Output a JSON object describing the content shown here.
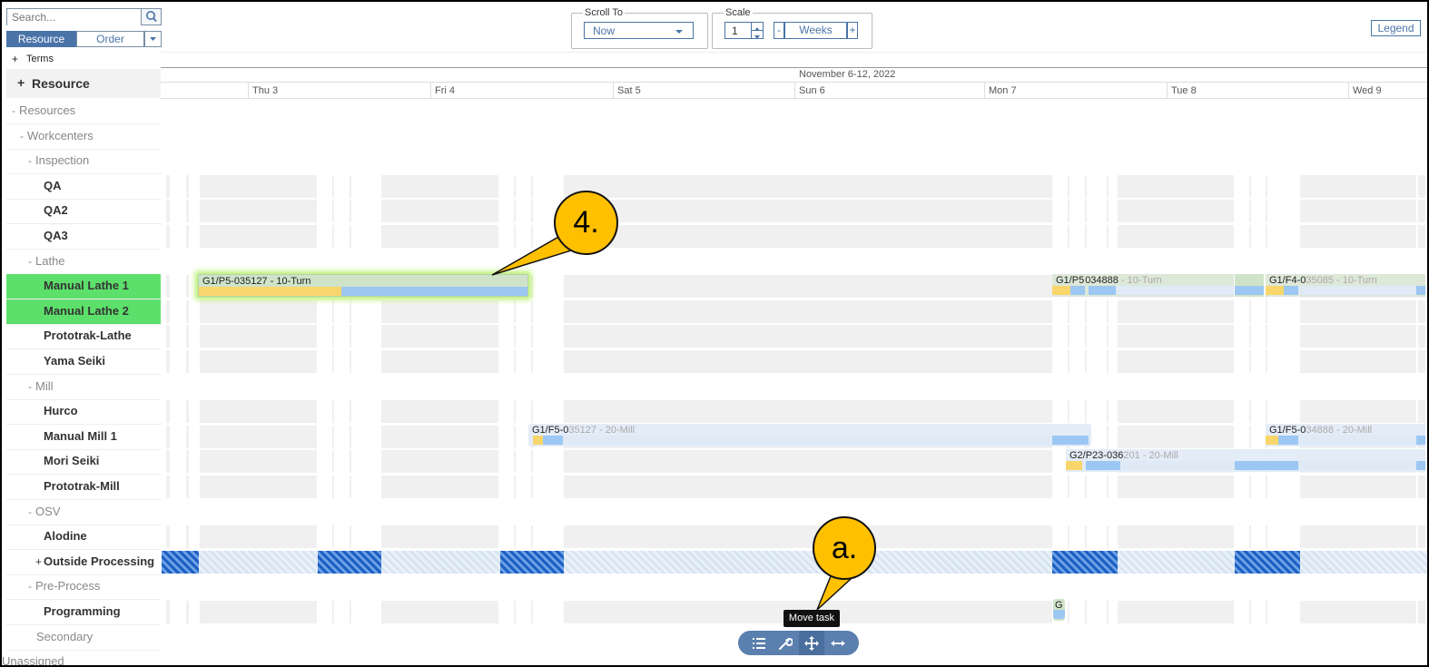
{
  "search": {
    "placeholder": "Search..."
  },
  "view_tabs": {
    "resource": "Resource",
    "order": "Order"
  },
  "terms_label": "Terms",
  "resource_header": "Resource",
  "tree": [
    {
      "label": "Resources",
      "type": "group",
      "depth": 0,
      "prefix": "-"
    },
    {
      "label": "Workcenters",
      "type": "group",
      "depth": 1,
      "prefix": "-"
    },
    {
      "label": "Inspection",
      "type": "group",
      "depth": 2,
      "prefix": "-"
    },
    {
      "label": "QA",
      "type": "leaf",
      "depth": 3
    },
    {
      "label": "QA2",
      "type": "leaf",
      "depth": 3
    },
    {
      "label": "QA3",
      "type": "leaf",
      "depth": 3
    },
    {
      "label": "Lathe",
      "type": "group",
      "depth": 2,
      "prefix": "-"
    },
    {
      "label": "Manual Lathe 1",
      "type": "leaf",
      "depth": 3,
      "selected": true
    },
    {
      "label": "Manual Lathe 2",
      "type": "leaf",
      "depth": 3,
      "selected": true
    },
    {
      "label": "Prototrak-Lathe",
      "type": "leaf",
      "depth": 3
    },
    {
      "label": "Yama Seiki",
      "type": "leaf",
      "depth": 3
    },
    {
      "label": "Mill",
      "type": "group",
      "depth": 2,
      "prefix": "-"
    },
    {
      "label": "Hurco",
      "type": "leaf",
      "depth": 3
    },
    {
      "label": "Manual Mill 1",
      "type": "leaf",
      "depth": 3
    },
    {
      "label": "Mori Seiki",
      "type": "leaf",
      "depth": 3
    },
    {
      "label": "Prototrak-Mill",
      "type": "leaf",
      "depth": 3
    },
    {
      "label": "OSV",
      "type": "group",
      "depth": 2,
      "prefix": "-"
    },
    {
      "label": "Alodine",
      "type": "leaf",
      "depth": 3
    },
    {
      "label": "Outside Processing",
      "type": "leaf",
      "depth": 3,
      "prefix": "+"
    },
    {
      "label": "Pre-Process",
      "type": "group",
      "depth": 2,
      "prefix": "-"
    },
    {
      "label": "Programming",
      "type": "leaf",
      "depth": 3
    },
    {
      "label": "Secondary",
      "type": "group",
      "depth": 2
    },
    {
      "label": "Unassigned",
      "type": "group",
      "depth": 1
    }
  ],
  "toolbar": {
    "scroll_to_label": "Scroll To",
    "scroll_to_value": "Now",
    "scale_label": "Scale",
    "scale_value": "1",
    "scale_unit": "Weeks",
    "minus": "-",
    "plus": "+",
    "legend_button": "Legend"
  },
  "timeline": {
    "week_label": "November 6-12, 2022",
    "days": [
      "Thu 3",
      "Fri 4",
      "Sat 5",
      "Sun 6",
      "Mon 7",
      "Tue 8",
      "Wed 9"
    ]
  },
  "tasks": {
    "lathe1_task": "G1/P5-035127 - 10-Turn",
    "lathe1_right_a_prefix": "G1/P5",
    "lathe1_right_a_mid": "034888",
    "lathe1_right_a_rest": " - 10-Turn",
    "lathe1_right_b_prefix": "G1/F4-0",
    "lathe1_right_b_rest": "35085 - 10-Turn",
    "mill1_task_prefix": "G1/F5-0",
    "mill1_task_rest": "35127 - 20-Mill",
    "mill1_right_prefix": "G1/F5-0",
    "mill1_right_rest": "34888 - 20-Mill",
    "mori_task_prefix": "G2/P23-036",
    "mori_task_rest": "201 - 20-Mill",
    "programming_task": "G"
  },
  "callouts": {
    "step4": "4.",
    "step_a": "a."
  },
  "bottom_toolbar": {
    "tooltip": "Move task",
    "icons": [
      "list-icon",
      "wrench-icon",
      "move-icon",
      "resize-icon"
    ]
  },
  "colors": {
    "accent": "#4a74a8",
    "selected_row": "#5de06b",
    "callout": "#ffc000",
    "task_green": "#cfe3c8",
    "task_yellow": "#f9d66b",
    "task_blue": "#9cc7f2"
  }
}
